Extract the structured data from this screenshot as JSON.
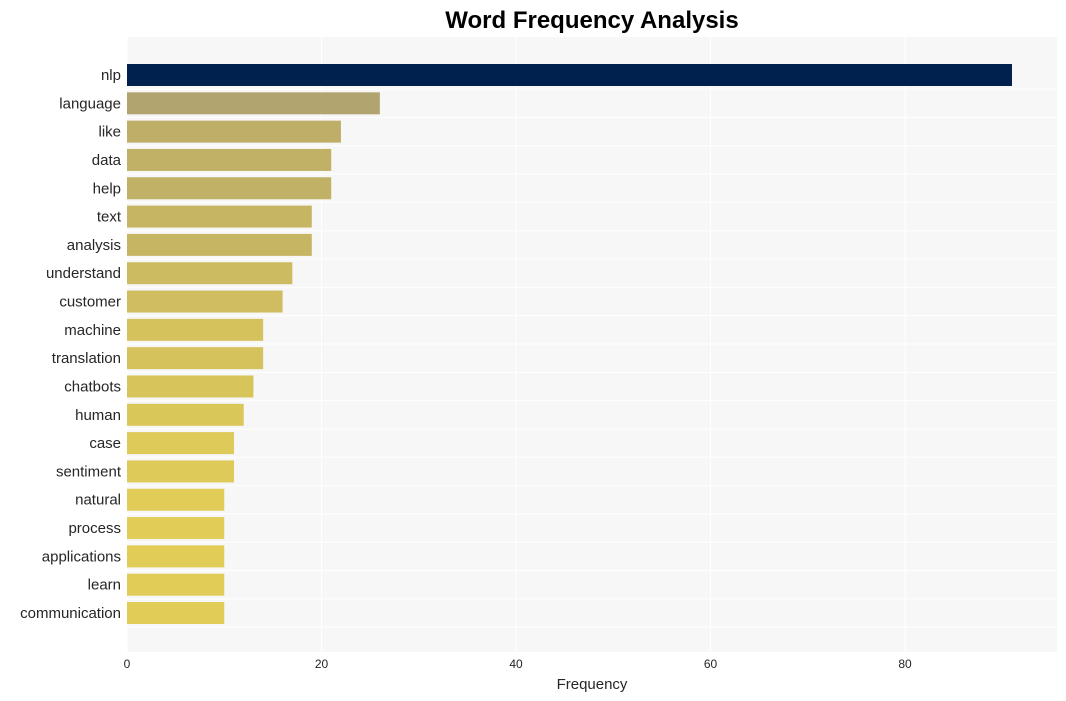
{
  "chart_data": {
    "type": "bar",
    "orientation": "horizontal",
    "title": "Word Frequency Analysis",
    "xlabel": "Frequency",
    "ylabel": "",
    "xlim": [
      0,
      95.5
    ],
    "xticks": [
      0,
      20,
      40,
      60,
      80
    ],
    "grid": true,
    "legend": "none",
    "categories": [
      "nlp",
      "language",
      "like",
      "data",
      "help",
      "text",
      "analysis",
      "understand",
      "customer",
      "machine",
      "translation",
      "chatbots",
      "human",
      "case",
      "sentiment",
      "natural",
      "process",
      "applications",
      "learn",
      "communication"
    ],
    "values": [
      91,
      26,
      22,
      21,
      21,
      19,
      19,
      17,
      16,
      14,
      14,
      13,
      12,
      11,
      11,
      10,
      10,
      10,
      10,
      10
    ],
    "colors": {
      "top_bar": "#00204e",
      "gradient_start": "#b2a46e",
      "gradient_end": "#e0cc57",
      "plot_background": "#f7f7f7",
      "grid": "#ffffff"
    }
  }
}
